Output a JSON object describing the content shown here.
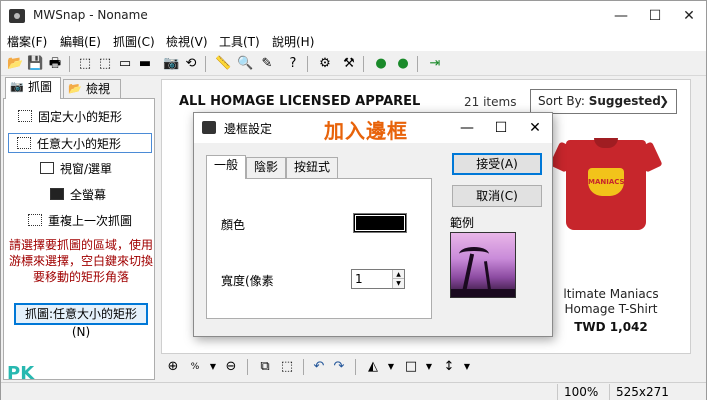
{
  "window": {
    "title": "MWSnap - Noname"
  },
  "window_controls": {
    "minimize": "—",
    "maximize": "☐",
    "close": "✕"
  },
  "menu": [
    "檔案(F)",
    "編輯(E)",
    "抓圖(C)",
    "檢視(V)",
    "工具(T)",
    "說明(H)"
  ],
  "left_panel": {
    "tabs": [
      {
        "label": "抓圖"
      },
      {
        "label": "檢視"
      }
    ],
    "commands": [
      {
        "label": "固定大小的矩形"
      },
      {
        "label": "任意大小的矩形"
      },
      {
        "label": "視窗/選單"
      },
      {
        "label": "全螢幕"
      },
      {
        "label": "重複上一次抓圖"
      }
    ],
    "hint": "請選擇要抓圖的區域，使用游標來選擇，空白鍵來切換要移動的矩形角落",
    "capture_button": "抓圖:任意大小的矩形(N)"
  },
  "canvas": {
    "heading": "ALL HOMAGE LICENSED APPAREL",
    "item_count": "21 items",
    "sort_label": "Sort By:",
    "sort_value": "Suggested",
    "product": {
      "logo_text": "MANIACS",
      "name_line1": "ltimate Maniacs",
      "name_line2": "Homage T-Shirt",
      "price": "TWD 1,042"
    }
  },
  "dialog": {
    "title": "邊框設定",
    "annotation": "加入邊框",
    "tabs": [
      "一般",
      "陰影",
      "按鈕式"
    ],
    "color_label": "顏色",
    "border_color": "#000000",
    "width_label": "寬度(像素",
    "width_value": "1",
    "ok_button": "接受(A)",
    "cancel_button": "取消(C)",
    "preview_label": "範例"
  },
  "status": {
    "zoom": "100%",
    "size": "525x271"
  },
  "watermark": "PK"
}
